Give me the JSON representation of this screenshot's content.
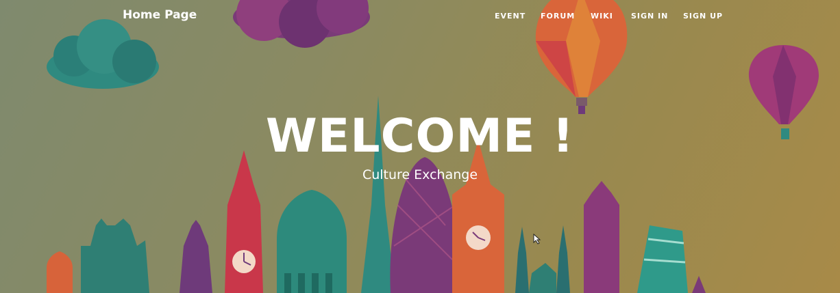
{
  "header": {
    "brand": "Home Page",
    "nav": [
      {
        "label": "EVENT"
      },
      {
        "label": "FORUM"
      },
      {
        "label": "WIKI"
      },
      {
        "label": "SIGN IN"
      },
      {
        "label": "SIGN UP"
      }
    ]
  },
  "hero": {
    "title": "WELCOME !",
    "subtitle": "Culture Exchange"
  },
  "colors": {
    "background": "#8c8a5c",
    "text": "#ffffff",
    "teal": "#2f8a80",
    "purple": "#6e3a7a",
    "orange": "#d7633a",
    "red": "#c9374a",
    "magenta": "#a03a78"
  }
}
